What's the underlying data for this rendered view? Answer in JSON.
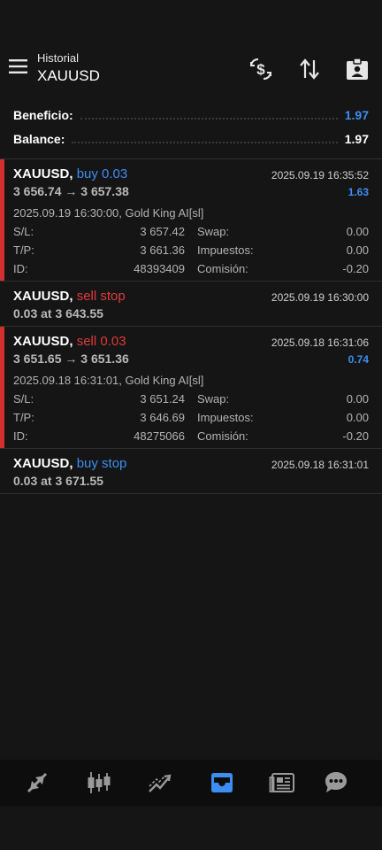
{
  "header": {
    "subtitle": "Historial",
    "title": "XAUUSD",
    "icons": [
      "menu-icon",
      "currency-exchange-icon",
      "sort-icon",
      "account-report-icon"
    ]
  },
  "summary": {
    "profit_label": "Beneficio:",
    "profit_value": "1.97",
    "balance_label": "Balance:",
    "balance_value": "1.97"
  },
  "trades": [
    {
      "symbol": "XAUUSD,",
      "kind": "buy 0.03",
      "time": "2025.09.19 16:35:52",
      "prices": "3 656.74 → 3 657.38",
      "profit": "1.63",
      "comment": "2025.09.19 16:30:00, Gold King AI[sl]",
      "sl_label": "S/L:",
      "sl": "3 657.42",
      "tp_label": "T/P:",
      "tp": "3 661.36",
      "id_label": "ID:",
      "id": "48393409",
      "swap_label": "Swap:",
      "swap": "0.00",
      "tax_label": "Impuestos:",
      "tax": "0.00",
      "commission_label": "Comisión:",
      "commission": "-0.20"
    },
    {
      "symbol": "XAUUSD,",
      "kind": "sell stop",
      "time": "2025.09.19 16:30:00",
      "detail": "0.03 at 3 643.55"
    },
    {
      "symbol": "XAUUSD,",
      "kind": "sell 0.03",
      "time": "2025.09.18 16:31:06",
      "prices": "3 651.65 → 3 651.36",
      "profit": "0.74",
      "comment": "2025.09.18 16:31:01, Gold King AI[sl]",
      "sl_label": "S/L:",
      "sl": "3 651.24",
      "tp_label": "T/P:",
      "tp": "3 646.69",
      "id_label": "ID:",
      "id": "48275066",
      "swap_label": "Swap:",
      "swap": "0.00",
      "tax_label": "Impuestos:",
      "tax": "0.00",
      "commission_label": "Comisión:",
      "commission": "-0.20"
    },
    {
      "symbol": "XAUUSD,",
      "kind": "buy stop",
      "time": "2025.09.18 16:31:01",
      "detail": "0.03 at 3 671.55"
    }
  ],
  "bottom_nav": {
    "items": [
      "quotes-icon",
      "chart-icon",
      "trade-icon",
      "history-icon",
      "news-icon",
      "messages-icon"
    ],
    "active": "history-icon"
  },
  "colors": {
    "accent": "#3d8ef2",
    "sell": "#e03a3a",
    "background": "#151515"
  }
}
